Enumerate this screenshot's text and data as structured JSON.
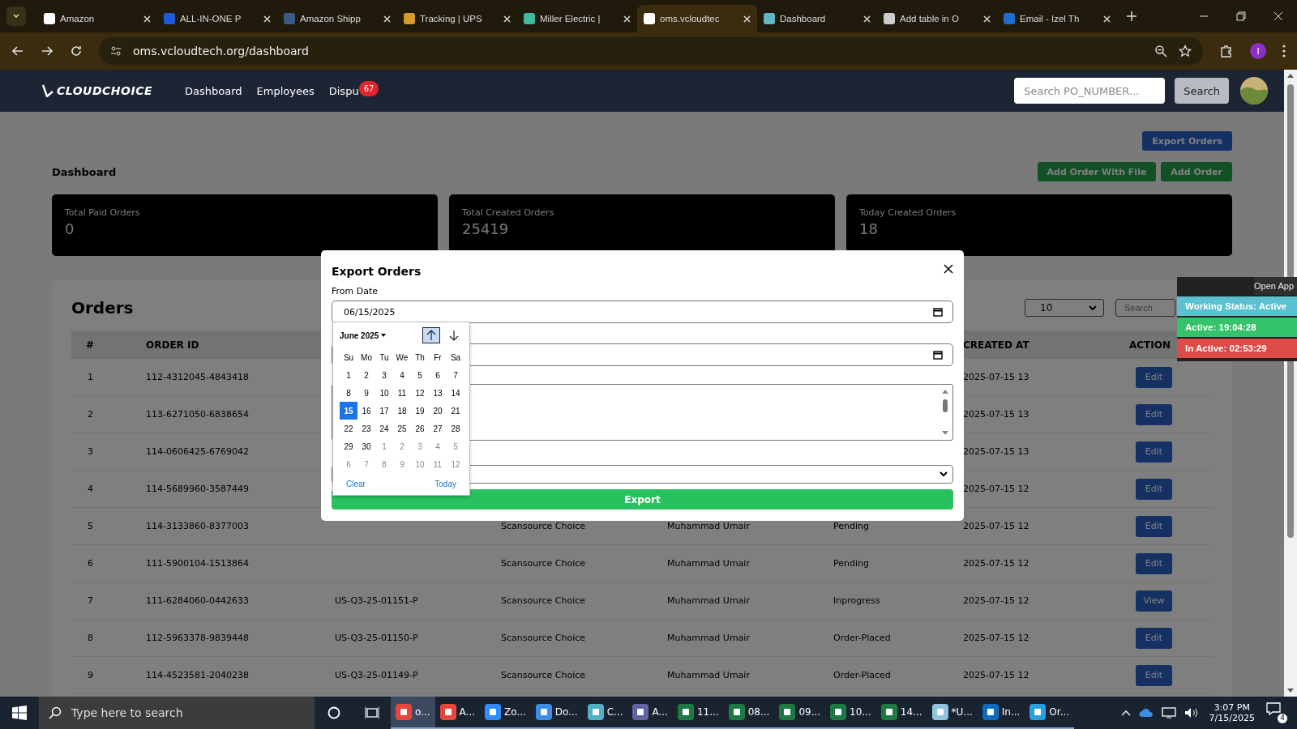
{
  "browser": {
    "tabs": [
      {
        "title": "Amazon",
        "selected": false,
        "color": "#ffffff"
      },
      {
        "title": "ALL-IN-ONE P",
        "selected": false,
        "color": "#1e5bd8"
      },
      {
        "title": "Amazon Shipp",
        "selected": false,
        "color": "#3b5a8a"
      },
      {
        "title": "Tracking | UPS",
        "selected": false,
        "color": "#d89a2a"
      },
      {
        "title": "Miller Electric |",
        "selected": false,
        "color": "#3fb9a0"
      },
      {
        "title": "oms.vcloudtec",
        "selected": true,
        "color": "#ffffff"
      },
      {
        "title": "Dashboard",
        "selected": false,
        "color": "#5fb8c8"
      },
      {
        "title": "Add table in O",
        "selected": false,
        "color": "#cccccc"
      },
      {
        "title": "Email - Izel Th",
        "selected": false,
        "color": "#1f6fd0"
      }
    ],
    "url": "oms.vcloudtech.org/dashboard",
    "profile": "I"
  },
  "navbar": {
    "brand": "CLOUDCHOICE",
    "links": [
      {
        "label": "Dashboard"
      },
      {
        "label": "Employees"
      },
      {
        "label": "Dispu",
        "badge": "67"
      }
    ],
    "search_placeholder": "Search PO_NUMBER...",
    "search_button": "Search"
  },
  "page": {
    "export_button": "Export Orders",
    "title": "Dashboard",
    "buttons": [
      "Add Order With File",
      "Add Order"
    ],
    "stats": [
      {
        "label": "Total Paid Orders",
        "value": "0"
      },
      {
        "label": "Total Created Orders",
        "value": "25419"
      },
      {
        "label": "Today Created Orders",
        "value": "18"
      }
    ]
  },
  "orders": {
    "title": "Orders",
    "page_size": "10",
    "search_placeholder": "Search",
    "columns": [
      "#",
      "ORDER ID",
      "CREATED AT",
      "ACTION"
    ],
    "rows": [
      {
        "num": "1",
        "order_id": "112-4312045-4843418",
        "created_at": "2025-07-15 13",
        "action": "Edit"
      },
      {
        "num": "2",
        "order_id": "113-6271050-6838654",
        "created_at": "2025-07-15 13",
        "action": "Edit"
      },
      {
        "num": "3",
        "order_id": "114-0606425-6769042",
        "created_at": "2025-07-15 13",
        "action": "Edit"
      },
      {
        "num": "4",
        "order_id": "114-5689960-3587449",
        "created_at": "2025-07-15 12",
        "action": "Edit"
      },
      {
        "num": "5",
        "order_id": "114-3133860-8377003",
        "column_4": "Scansource Choice",
        "column_5": "Muhammad Umair",
        "column_6": "Pending",
        "created_at": "2025-07-15 12",
        "action": "Edit"
      },
      {
        "num": "6",
        "order_id": "111-5900104-1513864",
        "column_4": "Scansource Choice",
        "column_5": "Muhammad Umair",
        "column_6": "Pending",
        "created_at": "2025-07-15 12",
        "action": "Edit"
      },
      {
        "num": "7",
        "order_id": "111-6284060-0442633",
        "column_3": "US-Q3-25-01151-P",
        "column_4": "Scansource Choice",
        "column_5": "Muhammad Umair",
        "column_6": "Inprogress",
        "created_at": "2025-07-15 12",
        "action": "View"
      },
      {
        "num": "8",
        "order_id": "112-5963378-9839448",
        "column_3": "US-Q3-25-01150-P",
        "column_4": "Scansource Choice",
        "column_5": "Muhammad Umair",
        "column_6": "Order-Placed",
        "created_at": "2025-07-15 12",
        "action": "Edit"
      },
      {
        "num": "9",
        "order_id": "114-4523581-2040238",
        "column_3": "US-Q3-25-01149-P",
        "column_4": "Scansource Choice",
        "column_5": "Muhammad Umair",
        "column_6": "Order-Placed",
        "created_at": "2025-07-15 12",
        "action": "Edit"
      }
    ]
  },
  "modal": {
    "title": "Export Orders",
    "from_label": "From Date",
    "from_value": "06/15/2025",
    "export_button": "Export",
    "calendar": {
      "month": "June 2025",
      "nav_buttons": [
        {
          "kind": "up",
          "focused": true
        },
        {
          "kind": "down",
          "focused": false
        }
      ],
      "weekdays": [
        "Su",
        "Mo",
        "Tu",
        "We",
        "Th",
        "Fr",
        "Sa"
      ],
      "days": [
        {
          "label": "1",
          "selected": false,
          "outside": false
        },
        {
          "label": "2",
          "selected": false,
          "outside": false
        },
        {
          "label": "3",
          "selected": false,
          "outside": false
        },
        {
          "label": "4",
          "selected": false,
          "outside": false
        },
        {
          "label": "5",
          "selected": false,
          "outside": false
        },
        {
          "label": "6",
          "selected": false,
          "outside": false
        },
        {
          "label": "7",
          "selected": false,
          "outside": false
        },
        {
          "label": "8",
          "selected": false,
          "outside": false
        },
        {
          "label": "9",
          "selected": false,
          "outside": false
        },
        {
          "label": "10",
          "selected": false,
          "outside": false
        },
        {
          "label": "11",
          "selected": false,
          "outside": false
        },
        {
          "label": "12",
          "selected": false,
          "outside": false
        },
        {
          "label": "13",
          "selected": false,
          "outside": false
        },
        {
          "label": "14",
          "selected": false,
          "outside": false
        },
        {
          "label": "15",
          "selected": true,
          "outside": false
        },
        {
          "label": "16",
          "selected": false,
          "outside": false
        },
        {
          "label": "17",
          "selected": false,
          "outside": false
        },
        {
          "label": "18",
          "selected": false,
          "outside": false
        },
        {
          "label": "19",
          "selected": false,
          "outside": false
        },
        {
          "label": "20",
          "selected": false,
          "outside": false
        },
        {
          "label": "21",
          "selected": false,
          "outside": false
        },
        {
          "label": "22",
          "selected": false,
          "outside": false
        },
        {
          "label": "23",
          "selected": false,
          "outside": false
        },
        {
          "label": "24",
          "selected": false,
          "outside": false
        },
        {
          "label": "25",
          "selected": false,
          "outside": false
        },
        {
          "label": "26",
          "selected": false,
          "outside": false
        },
        {
          "label": "27",
          "selected": false,
          "outside": false
        },
        {
          "label": "28",
          "selected": false,
          "outside": false
        },
        {
          "label": "29",
          "selected": false,
          "outside": false
        },
        {
          "label": "30",
          "selected": false,
          "outside": false
        },
        {
          "label": "1",
          "selected": false,
          "outside": true
        },
        {
          "label": "2",
          "selected": false,
          "outside": true
        },
        {
          "label": "3",
          "selected": false,
          "outside": true
        },
        {
          "label": "4",
          "selected": false,
          "outside": true
        },
        {
          "label": "5",
          "selected": false,
          "outside": true
        },
        {
          "label": "6",
          "selected": false,
          "outside": true
        },
        {
          "label": "7",
          "selected": false,
          "outside": true
        },
        {
          "label": "8",
          "selected": false,
          "outside": true
        },
        {
          "label": "9",
          "selected": false,
          "outside": true
        },
        {
          "label": "10",
          "selected": false,
          "outside": true
        },
        {
          "label": "11",
          "selected": false,
          "outside": true
        },
        {
          "label": "12",
          "selected": false,
          "outside": true
        }
      ],
      "clear": "Clear",
      "today": "Today"
    }
  },
  "tracker": {
    "open_app": "Open App",
    "statuses": [
      {
        "text": "Working Status: Active",
        "color": "#5bc0cf"
      },
      {
        "text": "Active: 19:04:28",
        "color": "#34c26a"
      },
      {
        "text": "In Active: 02:53:29",
        "color": "#dc4b45"
      }
    ]
  },
  "taskbar": {
    "search_placeholder": "Type here to search",
    "apps": [
      {
        "label": "o...",
        "color": "#e8453c",
        "active": true
      },
      {
        "label": "A...",
        "color": "#e8453c",
        "active": false
      },
      {
        "label": "Zo...",
        "color": "#2d8cff",
        "active": false
      },
      {
        "label": "Do...",
        "color": "#3a8ee6",
        "active": false
      },
      {
        "label": "C...",
        "color": "#4fb0c6",
        "active": false
      },
      {
        "label": "A...",
        "color": "#6264a7",
        "active": false
      },
      {
        "label": "11...",
        "color": "#1d7a45",
        "active": false
      },
      {
        "label": "08...",
        "color": "#1d7a45",
        "active": false
      },
      {
        "label": "09...",
        "color": "#1d7a45",
        "active": false
      },
      {
        "label": "10...",
        "color": "#1d7a45",
        "active": false
      },
      {
        "label": "14...",
        "color": "#1d7a45",
        "active": false
      },
      {
        "label": "*U...",
        "color": "#8fc3e0",
        "active": false
      },
      {
        "label": "In...",
        "color": "#0f6cbd",
        "active": false
      },
      {
        "label": "Or...",
        "color": "#2aa0e0",
        "active": false
      }
    ],
    "time": "3:07 PM",
    "date": "7/15/2025",
    "notifications": "4"
  }
}
